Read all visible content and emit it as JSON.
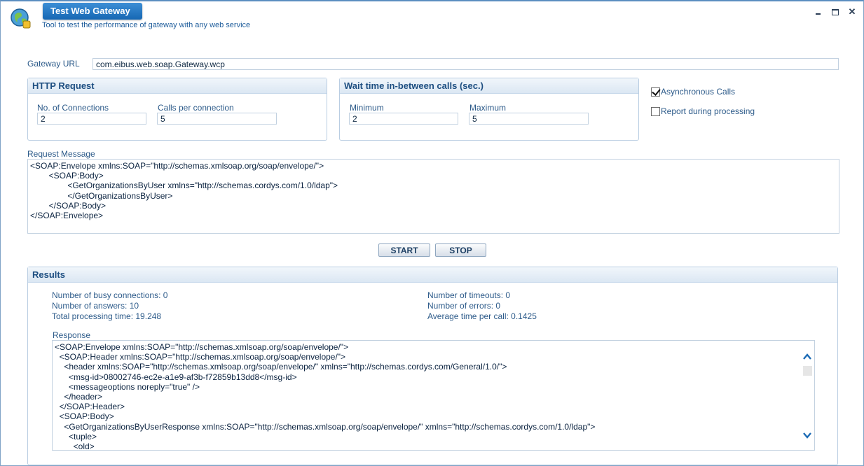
{
  "window": {
    "title": "Test Web Gateway",
    "subtitle": "Tool to test the performance of gateway with any web service"
  },
  "gateway": {
    "label": "Gateway URL",
    "value": "com.eibus.web.soap.Gateway.wcp"
  },
  "http_request": {
    "title": "HTTP Request",
    "connections_label": "No. of Connections",
    "connections_value": "2",
    "calls_label": "Calls per connection",
    "calls_value": "5"
  },
  "wait_time": {
    "title": "Wait time in-between calls (sec.)",
    "min_label": "Minimum",
    "min_value": "2",
    "max_label": "Maximum",
    "max_value": "5"
  },
  "options": {
    "async_label": "Asynchronous Calls",
    "async_checked": true,
    "report_label": "Report during processing",
    "report_checked": false
  },
  "request": {
    "label": "Request Message",
    "content": "<SOAP:Envelope xmlns:SOAP=\"http://schemas.xmlsoap.org/soap/envelope/\">\n        <SOAP:Body>\n                <GetOrganizationsByUser xmlns=\"http://schemas.cordys.com/1.0/ldap\">\n                </GetOrganizationsByUser>\n        </SOAP:Body>\n</SOAP:Envelope>"
  },
  "actions": {
    "start_label": "START",
    "stop_label": "STOP"
  },
  "results": {
    "title": "Results",
    "busy": "Number of busy connections: 0",
    "answers": "Number of answers: 10",
    "total_time": "Total processing time: 19.248",
    "timeouts": "Number of timeouts: 0",
    "errors": "Number of errors: 0",
    "avg_time": "Average time per call: 0.1425",
    "response_label": "Response",
    "response_content": "<SOAP:Envelope xmlns:SOAP=\"http://schemas.xmlsoap.org/soap/envelope/\">\n  <SOAP:Header xmlns:SOAP=\"http://schemas.xmlsoap.org/soap/envelope/\">\n    <header xmlns:SOAP=\"http://schemas.xmlsoap.org/soap/envelope/\" xmlns=\"http://schemas.cordys.com/General/1.0/\">\n      <msg-id>08002746-ec2e-a1e9-af3b-f72859b13dd8</msg-id>\n      <messageoptions noreply=\"true\" />\n    </header>\n  </SOAP:Header>\n  <SOAP:Body>\n    <GetOrganizationsByUserResponse xmlns:SOAP=\"http://schemas.xmlsoap.org/soap/envelope/\" xmlns=\"http://schemas.cordys.com/1.0/ldap\">\n      <tuple>\n        <old>"
  },
  "colors": {
    "accent": "#1667b3",
    "label": "#2d5b8a"
  }
}
